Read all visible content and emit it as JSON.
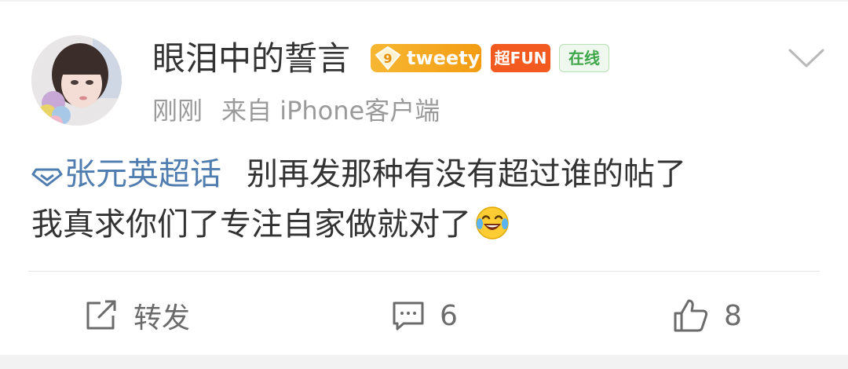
{
  "user": {
    "name": "眼泪中的誓言",
    "badges": {
      "tweety_level": "9",
      "tweety_label": "tweety",
      "fun_label": "超FUN",
      "online_label": "在线"
    }
  },
  "meta": {
    "time": "刚刚",
    "source": "来自 iPhone客户端"
  },
  "post": {
    "topic": "张元英超话",
    "text_line1": "别再发那种有没有超过谁的帖了",
    "text_line2": "我真求你们了专注自家做就对了",
    "emoji": "laughing-crying-emoji"
  },
  "actions": {
    "repost_label": "转发",
    "comment_count": "6",
    "like_count": "8"
  },
  "colors": {
    "link": "#507daf",
    "text": "#333333",
    "muted": "#9a9a9a",
    "fun_badge": "#f25a1f",
    "tweety_badge": "#f5a623",
    "online_badge": "#3fa64a"
  }
}
